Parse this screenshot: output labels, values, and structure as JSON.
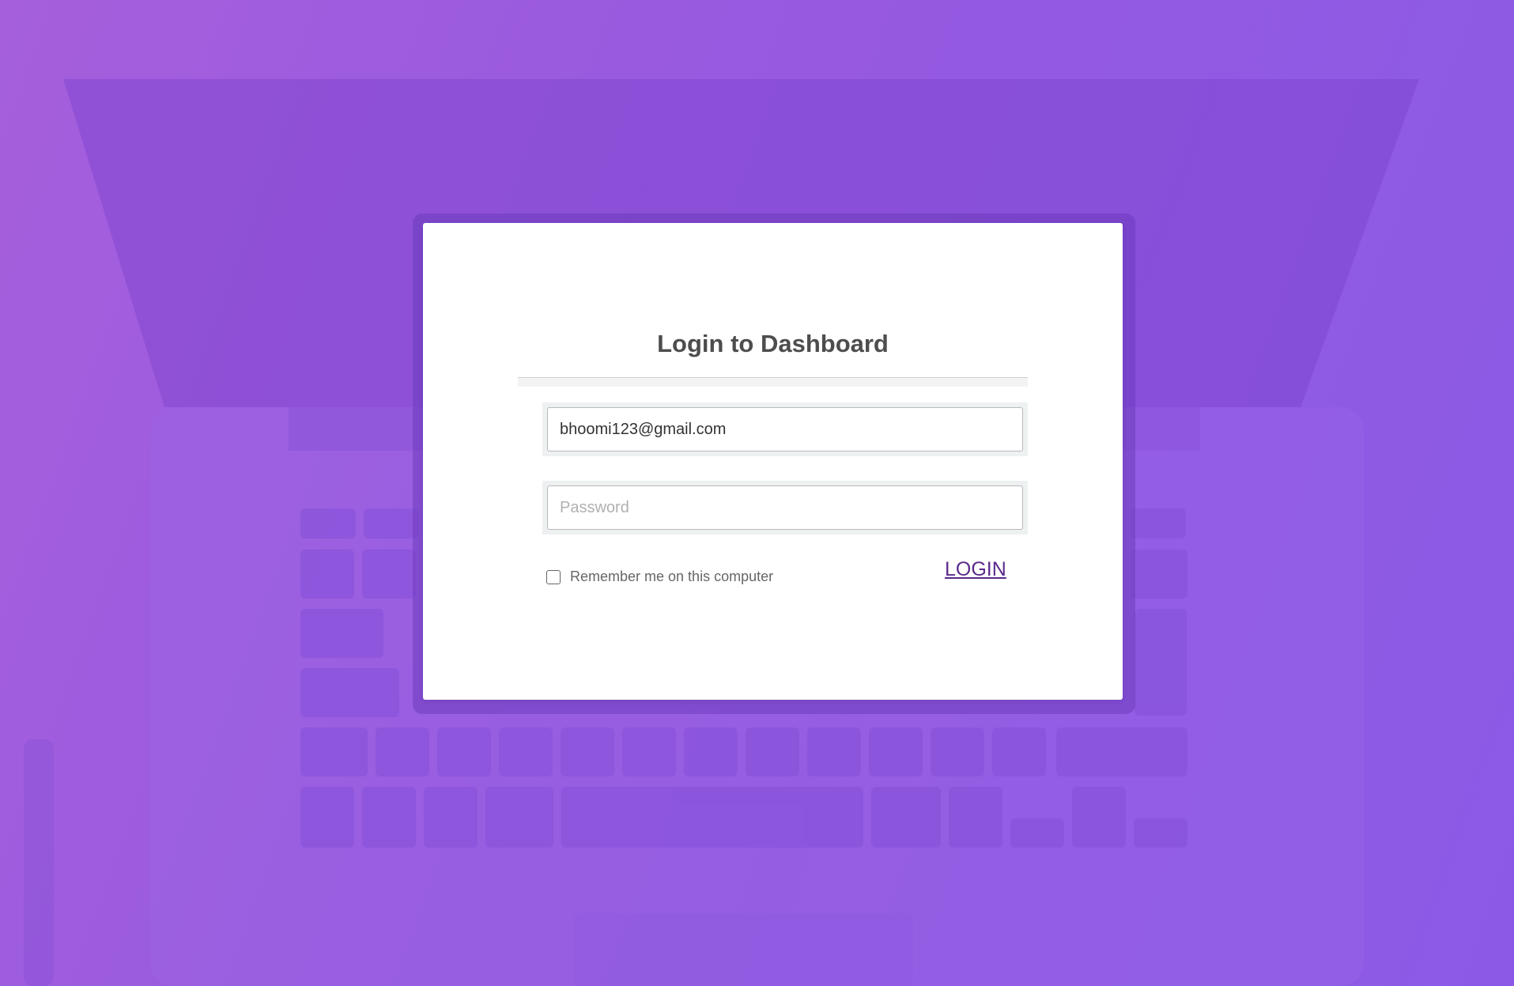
{
  "colors": {
    "background_gradient_start": "#a55fdc",
    "background_gradient_end": "#8a5ae6",
    "card": "#ffffff",
    "title": "#4d4d4d",
    "link": "#5a2a8c"
  },
  "login": {
    "title": "Login to Dashboard",
    "email": {
      "value": "bhoomi123@gmail.com",
      "placeholder": ""
    },
    "password": {
      "value": "",
      "placeholder": "Password"
    },
    "remember_label": "Remember me on this computer",
    "remember_checked": false,
    "submit_label": "LOGIN"
  }
}
